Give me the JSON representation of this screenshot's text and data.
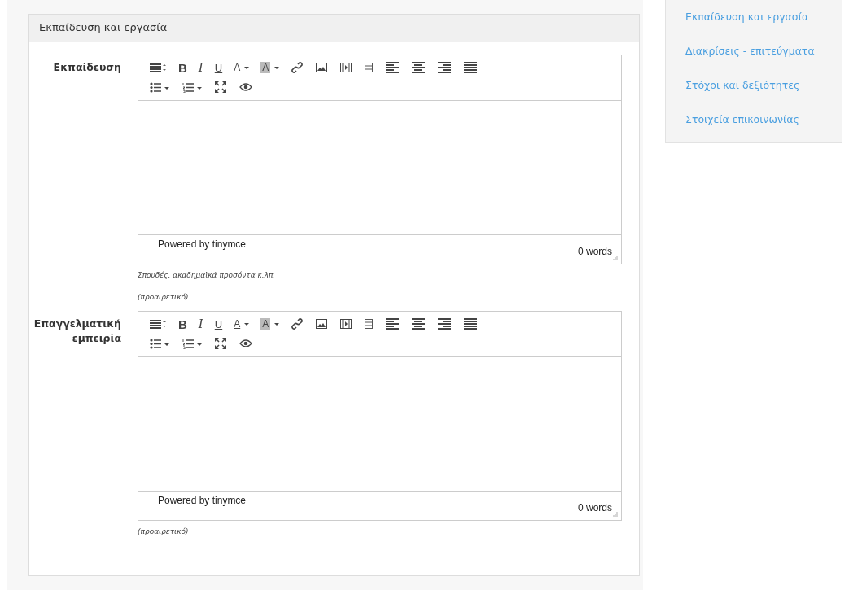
{
  "panel": {
    "title": "Εκπαίδευση και εργασία"
  },
  "fields": [
    {
      "label": "Εκπαίδευση",
      "toolbar": [
        [
          {
            "kind": "blocks"
          },
          {
            "kind": "bold",
            "label": "B"
          },
          {
            "kind": "italic",
            "label": "I"
          },
          {
            "kind": "underline",
            "label": "U"
          },
          {
            "kind": "forecolor",
            "label": "A"
          },
          {
            "kind": "backcolor",
            "label": "A"
          },
          {
            "kind": "link"
          },
          {
            "kind": "image"
          },
          {
            "kind": "media"
          },
          {
            "kind": "template"
          },
          {
            "kind": "alignleft"
          },
          {
            "kind": "aligncenter"
          },
          {
            "kind": "alignright"
          },
          {
            "kind": "justify"
          }
        ],
        [
          {
            "kind": "bullist"
          },
          {
            "kind": "numlist"
          },
          {
            "kind": "fullscreen"
          },
          {
            "kind": "preview"
          }
        ]
      ],
      "powered_by": "Powered by tinymce",
      "word_count": "0 words",
      "hints": [
        "Σπουδές, ακαδημαϊκά προσόντα κ.λπ.",
        "(προαιρετικό)"
      ]
    },
    {
      "label": "Επαγγελματική εμπειρία",
      "toolbar": [
        [
          {
            "kind": "blocks"
          },
          {
            "kind": "bold",
            "label": "B"
          },
          {
            "kind": "italic",
            "label": "I"
          },
          {
            "kind": "underline",
            "label": "U"
          },
          {
            "kind": "forecolor",
            "label": "A"
          },
          {
            "kind": "backcolor",
            "label": "A"
          },
          {
            "kind": "link"
          },
          {
            "kind": "image"
          },
          {
            "kind": "media"
          },
          {
            "kind": "template"
          },
          {
            "kind": "alignleft"
          },
          {
            "kind": "aligncenter"
          },
          {
            "kind": "alignright"
          },
          {
            "kind": "justify"
          }
        ],
        [
          {
            "kind": "bullist"
          },
          {
            "kind": "numlist"
          },
          {
            "kind": "fullscreen"
          },
          {
            "kind": "preview"
          }
        ]
      ],
      "powered_by": "Powered by tinymce",
      "word_count": "0 words",
      "hints": [
        "(προαιρετικό)"
      ]
    }
  ],
  "sidebar": {
    "items": [
      {
        "label": "Εκπαίδευση και εργασία"
      },
      {
        "label": "Διακρίσεις - επιτεύγματα"
      },
      {
        "label": "Στόχοι και δεξιότητες"
      },
      {
        "label": "Στοιχεία επικοινωνίας"
      }
    ]
  }
}
